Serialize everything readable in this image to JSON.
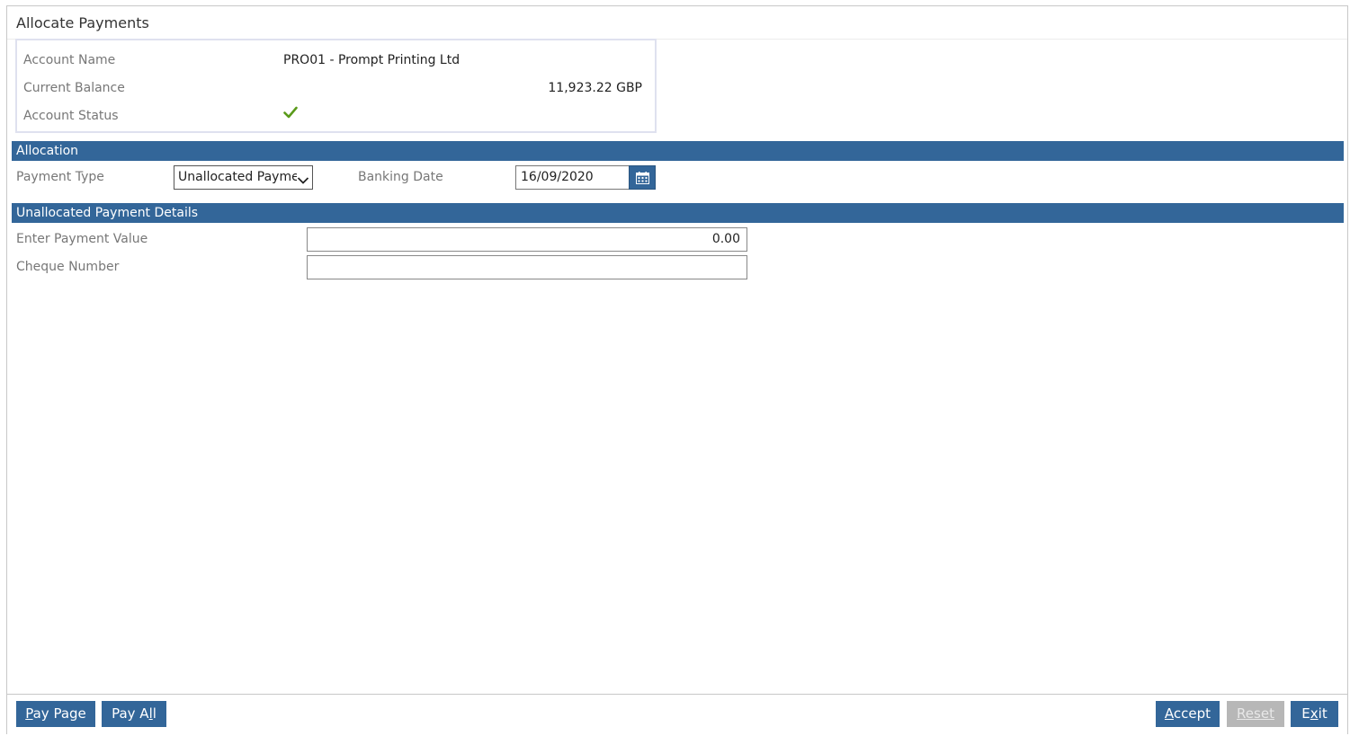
{
  "window": {
    "title": "Allocate Payments"
  },
  "account": {
    "name_label": "Account Name",
    "name_value": "PRO01 - Prompt Printing Ltd",
    "balance_label": "Current Balance",
    "balance_value": "11,923.22 GBP",
    "status_label": "Account Status",
    "status_icon": "check-icon",
    "status_color": "#5a9a1a"
  },
  "allocation": {
    "header": "Allocation",
    "payment_type_label": "Payment Type",
    "payment_type_value": "Unallocated Payme",
    "banking_date_label": "Banking Date",
    "banking_date_value": "16/09/2020"
  },
  "details": {
    "header": "Unallocated Payment Details",
    "payment_value_label": "Enter Payment Value",
    "payment_value": "0.00",
    "cheque_label": "Cheque Number",
    "cheque_value": ""
  },
  "footer": {
    "pay_page": {
      "accel": "P",
      "rest": "ay Page"
    },
    "pay_all": {
      "pre": "Pay A",
      "accel": "l",
      "rest": "l"
    },
    "accept": {
      "accel": "A",
      "rest": "ccept"
    },
    "reset": {
      "accel": "R",
      "rest": "eset"
    },
    "exit": {
      "pre": "E",
      "accel": "x",
      "rest": "it"
    }
  },
  "colors": {
    "accent": "#336699",
    "disabled": "#b7b7b7"
  }
}
